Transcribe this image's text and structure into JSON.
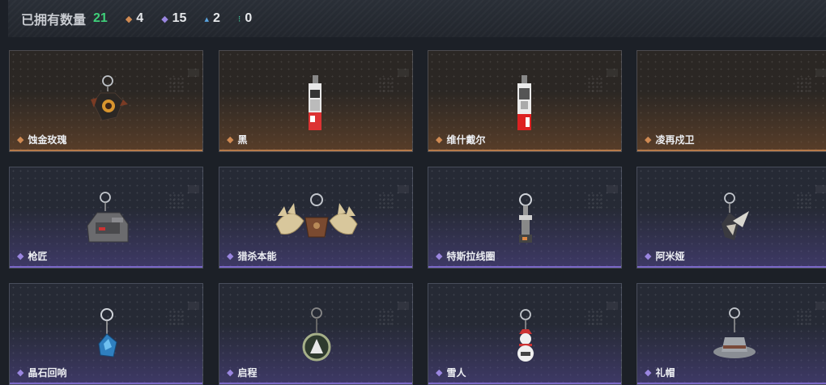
{
  "header": {
    "owned_label": "已拥有数量",
    "owned_count": "21",
    "stats": [
      {
        "icon": "orange-diamond-icon",
        "color": "#d08a52",
        "value": "4"
      },
      {
        "icon": "purple-diamond-icon",
        "color": "#9a86e0",
        "value": "15"
      },
      {
        "icon": "blue-triangle-icon",
        "color": "#5aa4e0",
        "value": "2"
      },
      {
        "icon": "green-dots-icon",
        "color": "#3fd0a0",
        "value": "0"
      }
    ]
  },
  "rarity_colors": {
    "orange": "#d08a52",
    "purple": "#9a86e0"
  },
  "items": [
    {
      "name": "蚀金玫瑰",
      "rarity": "orange"
    },
    {
      "name": "黑",
      "rarity": "orange"
    },
    {
      "name": "维什戴尔",
      "rarity": "orange"
    },
    {
      "name": "凌再戍卫",
      "rarity": "orange"
    },
    {
      "name": "枪匠",
      "rarity": "purple"
    },
    {
      "name": "猎杀本能",
      "rarity": "purple"
    },
    {
      "name": "特斯拉线圈",
      "rarity": "purple"
    },
    {
      "name": "阿米娅",
      "rarity": "purple"
    },
    {
      "name": "晶石回响",
      "rarity": "purple"
    },
    {
      "name": "启程",
      "rarity": "purple"
    },
    {
      "name": "雪人",
      "rarity": "purple"
    },
    {
      "name": "礼帽",
      "rarity": "purple"
    }
  ]
}
